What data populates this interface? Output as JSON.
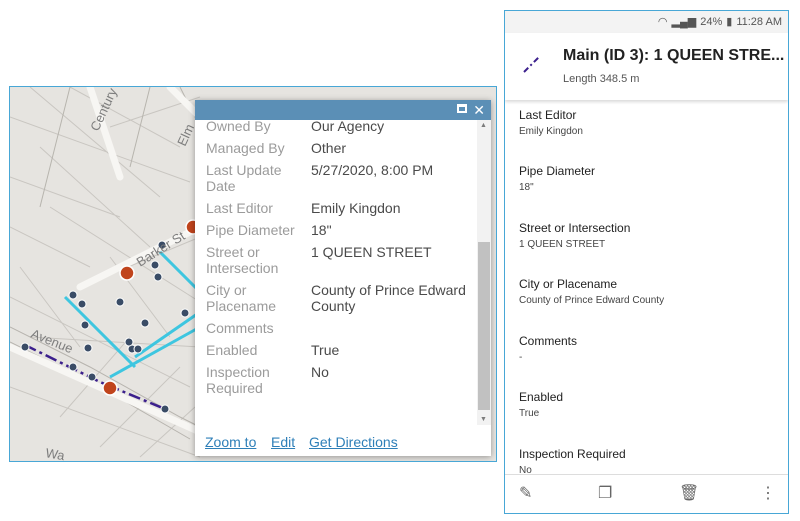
{
  "popup": {
    "attributes": [
      {
        "key": "Owned By",
        "value": "Our Agency"
      },
      {
        "key": "Managed By",
        "value": "Other"
      },
      {
        "key": "Last Update Date",
        "value": "5/27/2020, 8:00 PM"
      },
      {
        "key": "Last Editor",
        "value": "Emily Kingdon"
      },
      {
        "key": "Pipe Diameter",
        "value": "18\""
      },
      {
        "key": "Street or Intersection",
        "value": "1 QUEEN STREET"
      },
      {
        "key": "City or Placename",
        "value": "County of Prince Edward County"
      },
      {
        "key": "Comments",
        "value": ""
      },
      {
        "key": "Enabled",
        "value": "True"
      },
      {
        "key": "Inspection Required",
        "value": "No"
      }
    ],
    "actions": {
      "zoom": "Zoom to",
      "edit": "Edit",
      "directions": "Get Directions"
    }
  },
  "map": {
    "street_labels": [
      "Century",
      "Elm",
      "Barker St",
      "Avenue",
      "Wa"
    ]
  },
  "phone": {
    "status": {
      "battery": "24%",
      "time": "11:28 AM"
    },
    "title": "Main (ID 3): 1 QUEEN STRE...",
    "subtitle": "Length 348.5 m",
    "fields": [
      {
        "label": "Last Editor",
        "value": "Emily Kingdon"
      },
      {
        "label": "Pipe Diameter",
        "value": "18\""
      },
      {
        "label": "Street or Intersection",
        "value": "1 QUEEN STREET"
      },
      {
        "label": "City or Placename",
        "value": "County of Prince Edward County"
      },
      {
        "label": "Comments",
        "value": "-"
      },
      {
        "label": "Enabled",
        "value": "True"
      },
      {
        "label": "Inspection Required",
        "value": "No"
      }
    ]
  },
  "colors": {
    "accent_blue": "#2e7fb8",
    "header_blue": "#5b8fb6",
    "pipe_cyan": "#3ec6e0",
    "pipe_purple": "#3b1f8c",
    "hydrant_red": "#c0441c"
  }
}
